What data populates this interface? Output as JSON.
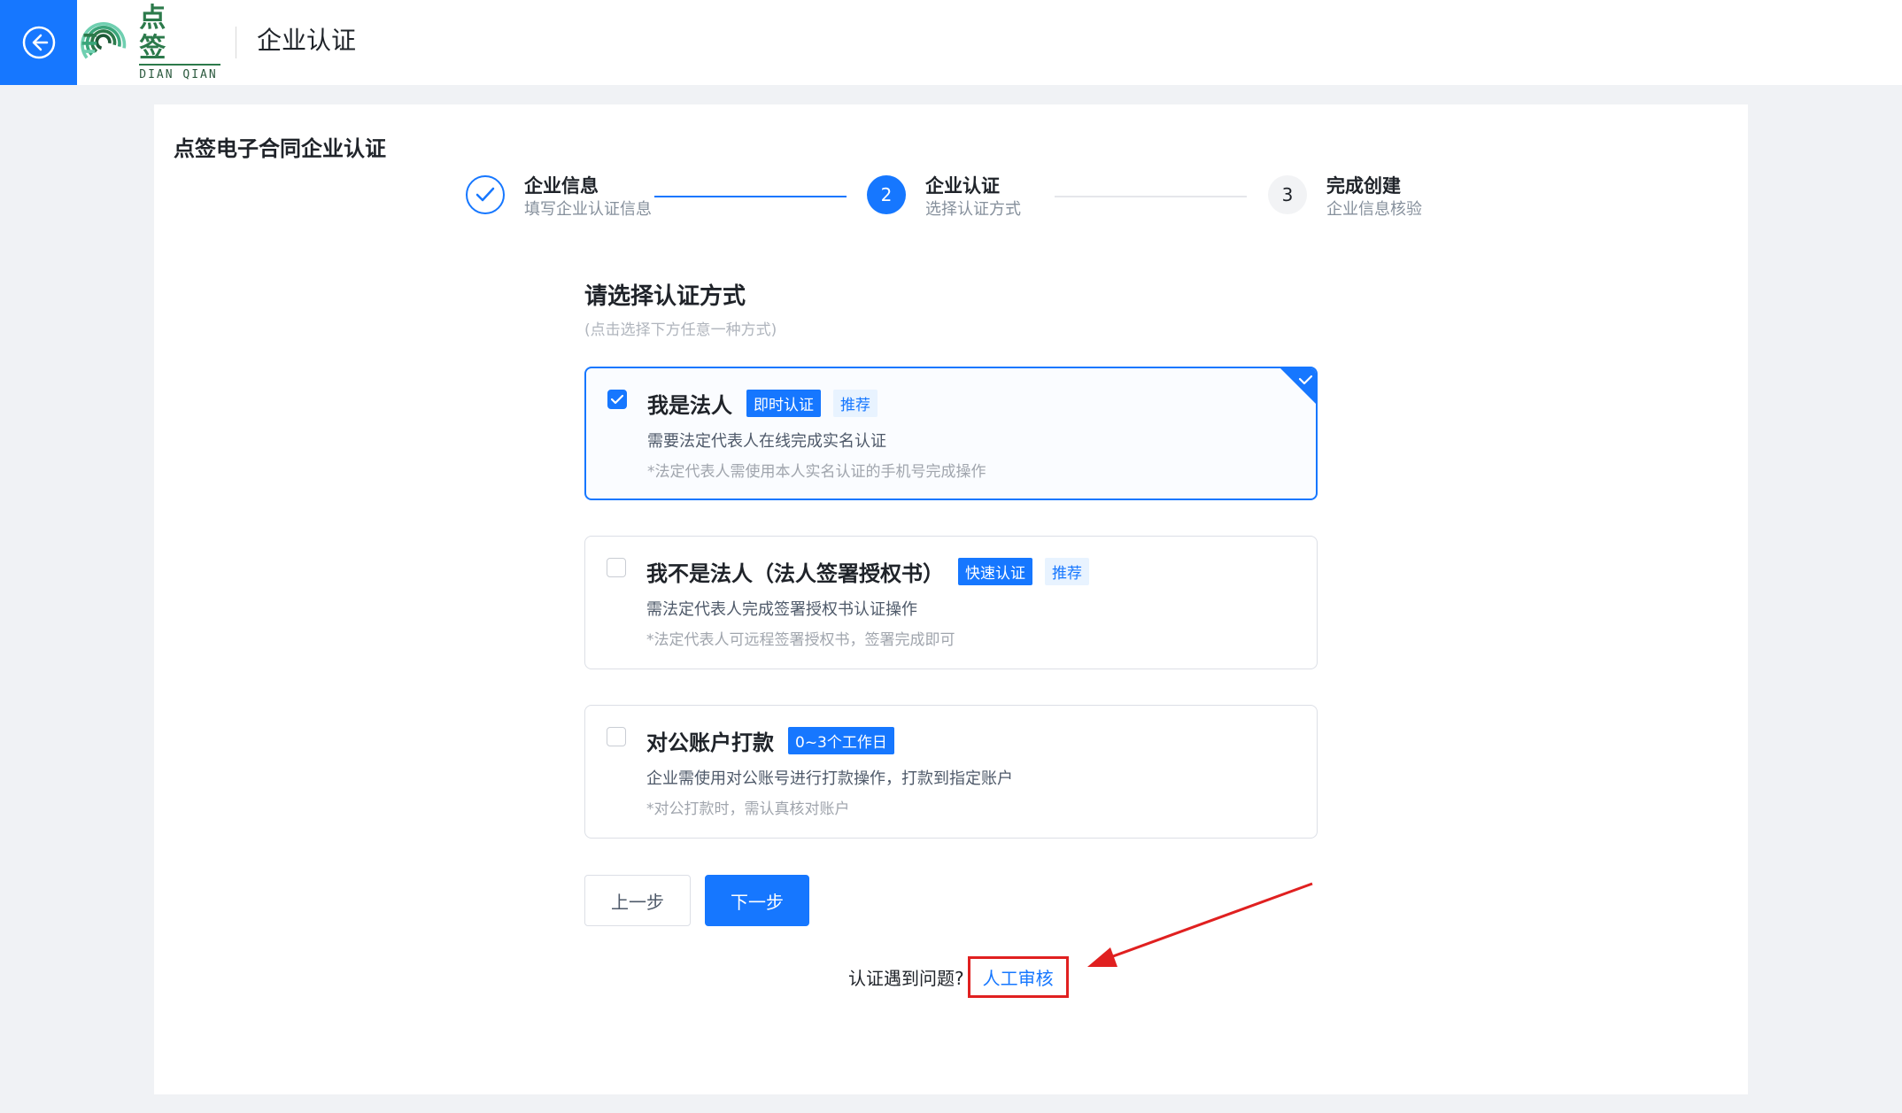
{
  "header": {
    "logo_cn": "点 签",
    "logo_en": "DIAN QIAN",
    "title": "企业认证"
  },
  "page": {
    "title": "点签电子合同企业认证"
  },
  "steps": [
    {
      "number": "1",
      "title": "企业信息",
      "desc": "填写企业认证信息",
      "status": "done"
    },
    {
      "number": "2",
      "title": "企业认证",
      "desc": "选择认证方式",
      "status": "active"
    },
    {
      "number": "3",
      "title": "完成创建",
      "desc": "企业信息核验",
      "status": "wait"
    }
  ],
  "method": {
    "title": "请选择认证方式",
    "hint": "(点击选择下方任意一种方式)",
    "options": [
      {
        "title": "我是法人",
        "tag": "即时认证",
        "tag2": "推荐",
        "desc": "需要法定代表人在线完成实名认证",
        "note": "*法定代表人需使用本人实名认证的手机号完成操作",
        "selected": true
      },
      {
        "title": "我不是法人（法人签署授权书）",
        "tag": "快速认证",
        "tag2": "推荐",
        "desc": "需法定代表人完成签署授权书认证操作",
        "note": "*法定代表人可远程签署授权书，签署完成即可",
        "selected": false
      },
      {
        "title": "对公账户打款",
        "tag": "0~3个工作日",
        "desc": "企业需使用对公账号进行打款操作，打款到指定账户",
        "note": "*对公打款时，需认真核对账户",
        "selected": false
      }
    ]
  },
  "buttons": {
    "prev": "上一步",
    "next": "下一步"
  },
  "help": {
    "text": "认证遇到问题?",
    "link": "人工审核"
  },
  "colors": {
    "primary": "#1677ff",
    "highlight": "#e02020",
    "logo": "#2c7a4b"
  }
}
